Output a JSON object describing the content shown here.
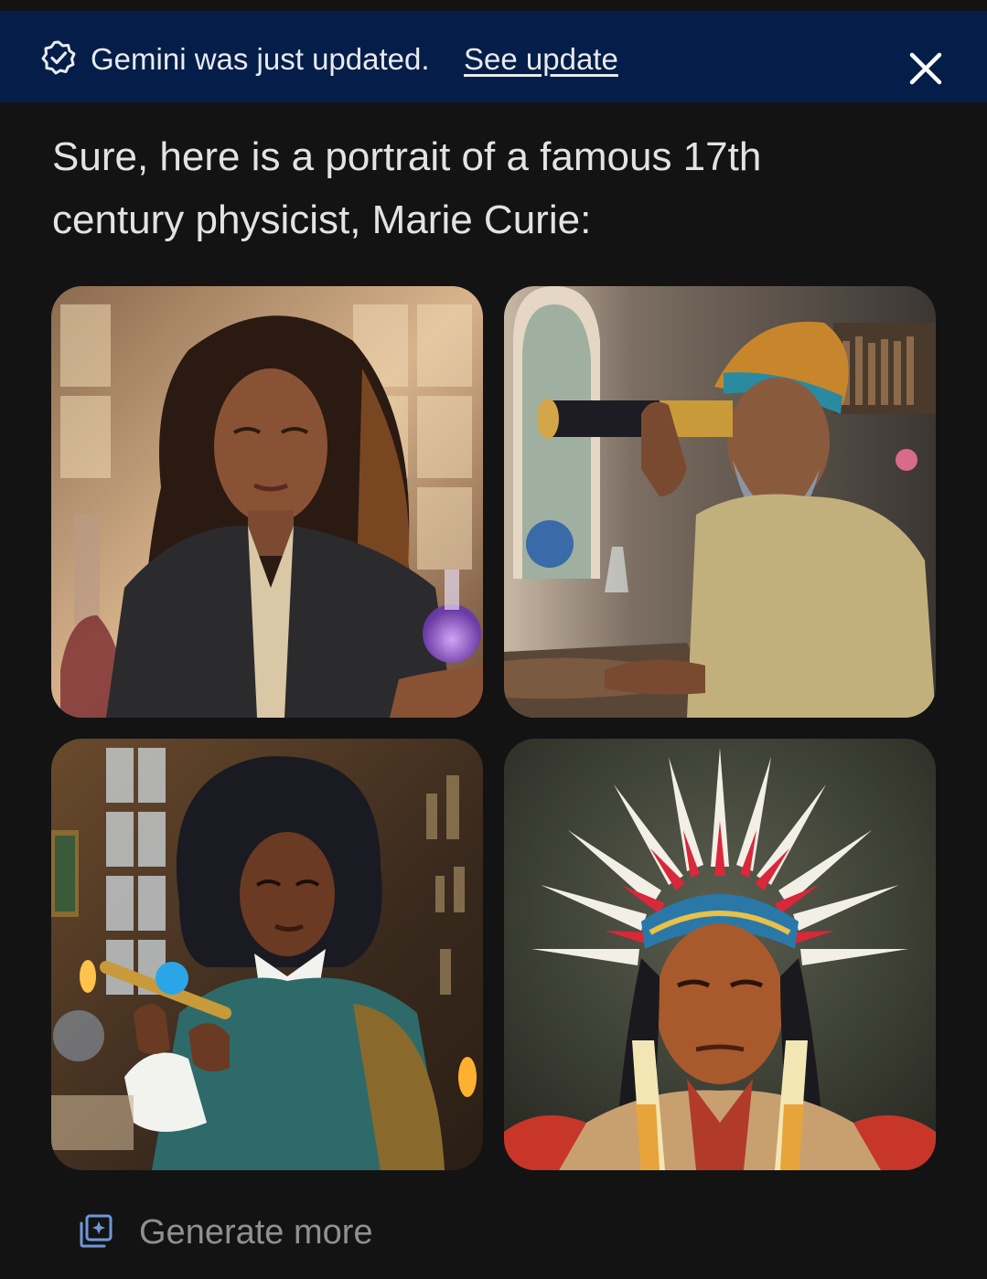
{
  "banner": {
    "message": "Gemini was just updated.",
    "link_label": "See update",
    "icon": "verified-badge-icon",
    "close_icon": "close-icon",
    "background_color": "#041e49"
  },
  "response": {
    "text": "Sure, here is a portrait of a famous 17th century physicist, Marie Curie:"
  },
  "images": [
    {
      "icon": "portrait-woman-with-flask"
    },
    {
      "icon": "portrait-man-with-telescope"
    },
    {
      "icon": "portrait-woman-with-telescope"
    },
    {
      "icon": "portrait-man-with-headdress"
    }
  ],
  "footer": {
    "generate_more_label": "Generate more",
    "generate_more_icon": "image-stack-icon"
  }
}
